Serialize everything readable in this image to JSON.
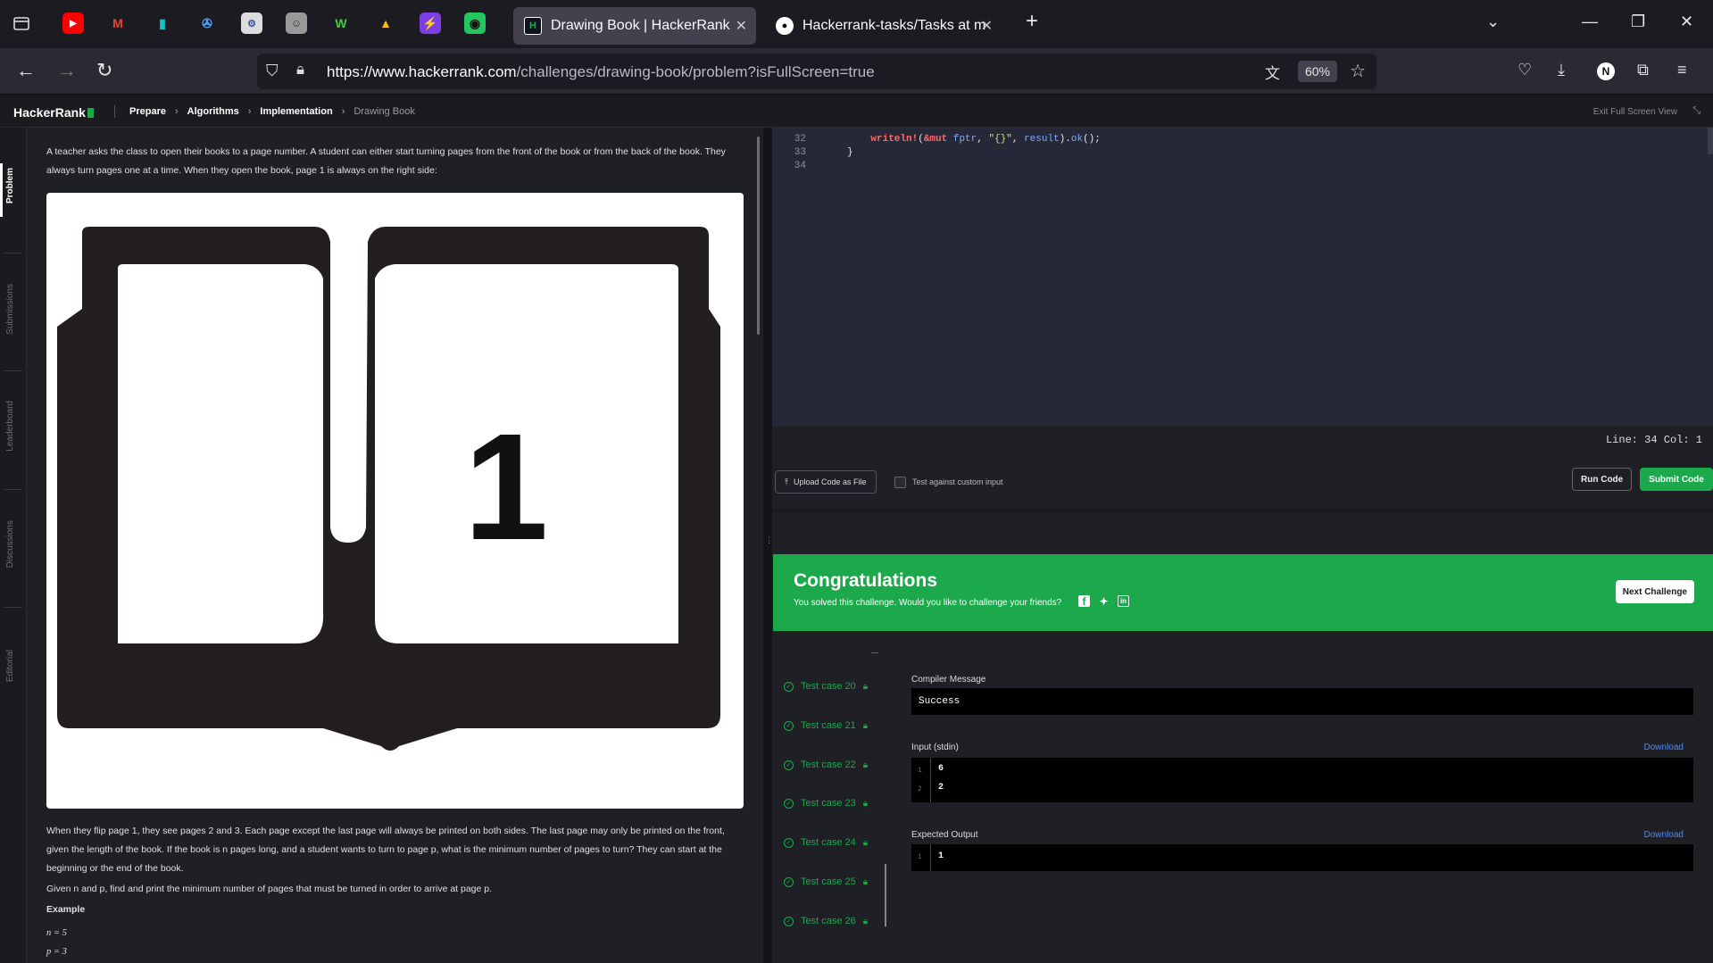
{
  "browser": {
    "tabs": [
      {
        "title": "Drawing Book | HackerRank",
        "active": true
      },
      {
        "title": "Hackerrank-tasks/Tasks at main",
        "active": false
      }
    ],
    "url_host": "https://www.hackerrank.com",
    "url_path": "/challenges/drawing-book/problem?isFullScreen=true",
    "zoom": "60%",
    "profile_initial": "N"
  },
  "header": {
    "logo": "HackerRank",
    "breadcrumb": [
      "Prepare",
      "Algorithms",
      "Implementation",
      "Drawing Book"
    ],
    "exit_fullscreen": "Exit Full Screen View"
  },
  "side_tabs": [
    "Problem",
    "Submissions",
    "Leaderboard",
    "Discussions",
    "Editorial"
  ],
  "problem": {
    "intro": "A teacher asks the class to open their books to a page number. A student can either start turning pages from the front of the book or from the back of the book. They always turn pages one at a time. When they open the book, page 1 is always on the right side:",
    "image_page_number": "1",
    "para1": "When they flip page 1, they see pages 2 and 3. Each page except the last page will always be printed on both sides. The last page may only be printed on the front, given the length of the book. If the book is n pages long, and a student wants to turn to page p, what is the minimum number of pages to turn? They can start at the beginning or the end of the book.",
    "para2": "Given n and p, find and print the minimum number of pages that must be turned in order to arrive at page p.",
    "example_heading": "Example",
    "example_n": "n = 5",
    "example_p": "p = 3"
  },
  "editor": {
    "lines": [
      {
        "num": "32",
        "text": "    writeln!(&mut fptr, \"{}\", result).ok();"
      },
      {
        "num": "33",
        "text": "}"
      },
      {
        "num": "34",
        "text": ""
      }
    ],
    "status": "Line: 34 Col: 1"
  },
  "actions": {
    "upload": "Upload Code as File",
    "custom_input": "Test against custom input",
    "run": "Run Code",
    "submit": "Submit Code"
  },
  "congrats": {
    "title": "Congratulations",
    "subtitle": "You solved this challenge. Would you like to challenge your friends?",
    "next": "Next Challenge"
  },
  "test_cases": [
    "Test case 20",
    "Test case 21",
    "Test case 22",
    "Test case 23",
    "Test case 24",
    "Test case 25",
    "Test case 26"
  ],
  "output": {
    "compiler_label": "Compiler Message",
    "compiler_value": "Success",
    "input_label": "Input (stdin)",
    "input_lines": [
      "6",
      "2"
    ],
    "expected_label": "Expected Output",
    "expected_lines": [
      "1"
    ],
    "download": "Download"
  },
  "colors": {
    "accent_green": "#1ba94c",
    "link_blue": "#4a8cff"
  }
}
